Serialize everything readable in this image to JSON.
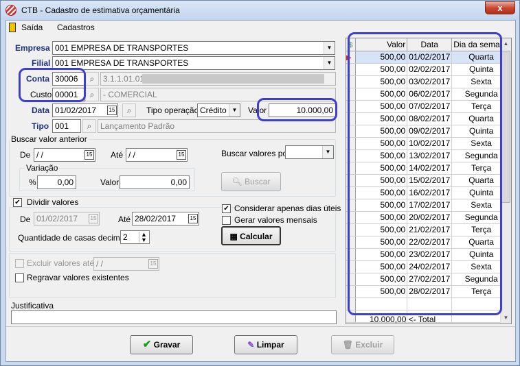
{
  "window": {
    "title": "CTB - Cadastro de estimativa orçamentária",
    "close_label": "x"
  },
  "menu": {
    "items": [
      "Saída",
      "Cadastros"
    ]
  },
  "form": {
    "empresa_label": "Empresa",
    "empresa_value": "001 EMPRESA DE TRANSPORTES",
    "filial_label": "Filial",
    "filial_value": "001 EMPRESA DE TRANSPORTES",
    "conta_label": "Conta",
    "conta_value": "30006",
    "conta_desc": "3.1.1.01.01",
    "custo_label": "Custo",
    "custo_value": "00001",
    "custo_desc": "- COMERCIAL",
    "data_label": "Data",
    "data_value": "01/02/2017",
    "tipo_operacao_label": "Tipo operação",
    "tipo_operacao_value": "Crédito",
    "valor_label": "Valor",
    "valor_value": "10.000,00",
    "tipo_label": "Tipo",
    "tipo_value": "001",
    "tipo_desc": "Lançamento Padrão"
  },
  "buscar": {
    "group_title": "Buscar valor anterior",
    "de_label": "De",
    "de_value": "/ /",
    "ate_label": "Até",
    "ate_value": "/ /",
    "buscar_por_label": "Buscar valores por",
    "buscar_por_value": "",
    "variacao_title": "Variação",
    "pct_label": "%",
    "pct_value": "0,00",
    "valor_label": "Valor",
    "valor_value": "0,00",
    "buscar_button": "Buscar"
  },
  "dividir": {
    "checkbox_label": "Dividir valores",
    "de_label": "De",
    "de_value": "01/02/2017",
    "ate_label": "Até",
    "ate_value": "28/02/2017",
    "casas_label": "Quantidade de casas decimais",
    "casas_value": "2",
    "dias_uteis_label": "Considerar apenas dias úteis",
    "mensais_label": "Gerar valores mensais",
    "calcular_button": "Calcular"
  },
  "options": {
    "excluir_ate_label": "Excluir valores até",
    "excluir_ate_value": "/ /",
    "regravar_label": "Regravar valores existentes"
  },
  "justificativa": {
    "label": "Justificativa",
    "value": ""
  },
  "grid": {
    "headers": [
      "Valor",
      "Data",
      "Dia da semana"
    ],
    "rows": [
      [
        "500,00",
        "01/02/2017",
        "Quarta"
      ],
      [
        "500,00",
        "02/02/2017",
        "Quinta"
      ],
      [
        "500,00",
        "03/02/2017",
        "Sexta"
      ],
      [
        "500,00",
        "06/02/2017",
        "Segunda"
      ],
      [
        "500,00",
        "07/02/2017",
        "Terça"
      ],
      [
        "500,00",
        "08/02/2017",
        "Quarta"
      ],
      [
        "500,00",
        "09/02/2017",
        "Quinta"
      ],
      [
        "500,00",
        "10/02/2017",
        "Sexta"
      ],
      [
        "500,00",
        "13/02/2017",
        "Segunda"
      ],
      [
        "500,00",
        "14/02/2017",
        "Terça"
      ],
      [
        "500,00",
        "15/02/2017",
        "Quarta"
      ],
      [
        "500,00",
        "16/02/2017",
        "Quinta"
      ],
      [
        "500,00",
        "17/02/2017",
        "Sexta"
      ],
      [
        "500,00",
        "20/02/2017",
        "Segunda"
      ],
      [
        "500,00",
        "21/02/2017",
        "Terça"
      ],
      [
        "500,00",
        "22/02/2017",
        "Quarta"
      ],
      [
        "500,00",
        "23/02/2017",
        "Quinta"
      ],
      [
        "500,00",
        "24/02/2017",
        "Sexta"
      ],
      [
        "500,00",
        "27/02/2017",
        "Segunda"
      ],
      [
        "500,00",
        "28/02/2017",
        "Terça"
      ]
    ],
    "footer": "10.000,00 <- Total"
  },
  "buttons": {
    "gravar": "Gravar",
    "limpar": "Limpar",
    "excluir": "Excluir"
  },
  "colors": {
    "highlight": "#3c3fd0",
    "label_blue": "#1c2f7a"
  }
}
